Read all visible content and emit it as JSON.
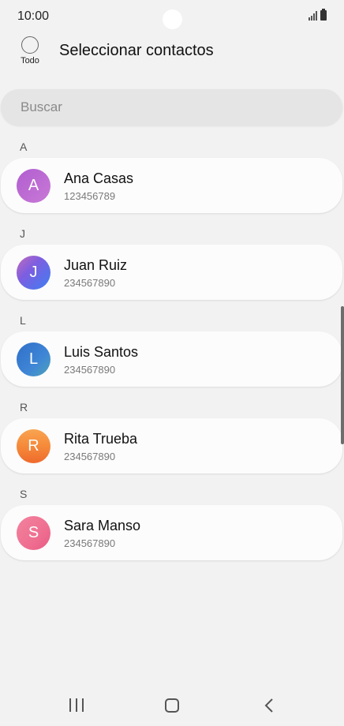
{
  "status": {
    "time": "10:00"
  },
  "header": {
    "select_all_label": "Todo",
    "title": "Seleccionar contactos"
  },
  "search": {
    "placeholder": "Buscar",
    "value": ""
  },
  "sections": [
    {
      "letter": "A",
      "contact": {
        "initial": "A",
        "name": "Ana Casas",
        "number": "123456789",
        "color": "#b96bd0"
      }
    },
    {
      "letter": "J",
      "contact": {
        "initial": "J",
        "name": "Juan Ruiz",
        "number": "234567890",
        "color": "#6a63e6"
      }
    },
    {
      "letter": "L",
      "contact": {
        "initial": "L",
        "name": "Luis Santos",
        "number": "234567890",
        "color": "#3e7fd0"
      }
    },
    {
      "letter": "R",
      "contact": {
        "initial": "R",
        "name": "Rita Trueba",
        "number": "234567890",
        "color": "#f58a3a"
      }
    },
    {
      "letter": "S",
      "contact": {
        "initial": "S",
        "name": "Sara Manso",
        "number": "234567890",
        "color": "#ef6f91"
      }
    }
  ],
  "icons": {
    "select_all": "circle-checkbox-icon",
    "signal": "signal-icon",
    "battery": "battery-icon",
    "recent": "recent-apps-icon",
    "home": "home-icon",
    "back": "back-icon"
  }
}
